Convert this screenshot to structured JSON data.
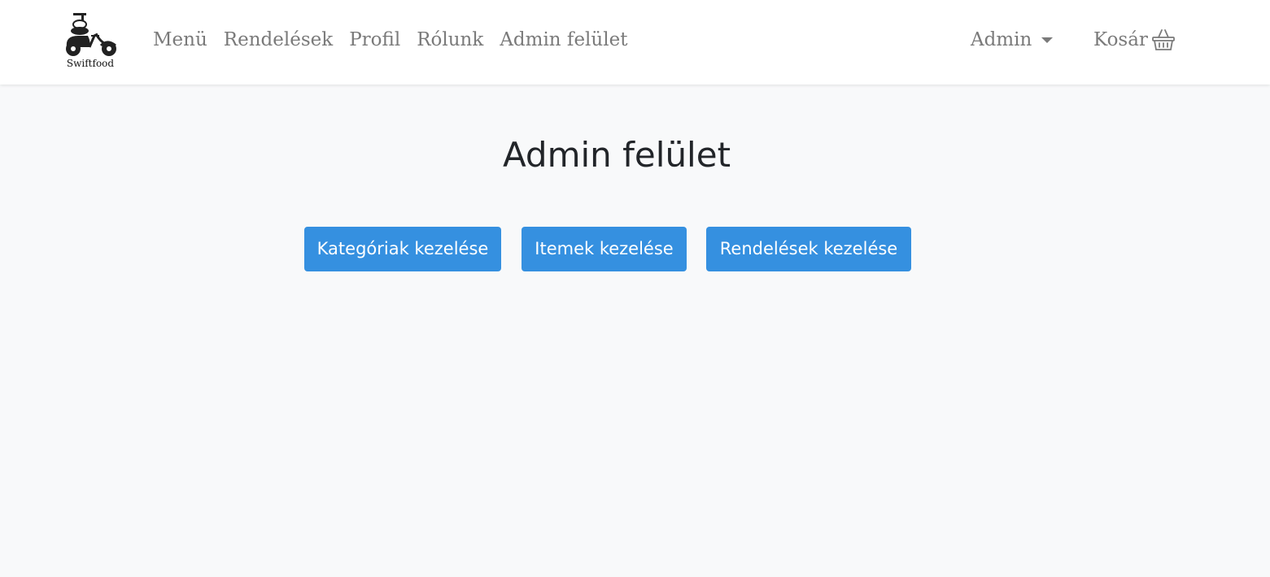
{
  "navbar": {
    "logo_text": "Swiftfood",
    "links": [
      "Menü",
      "Rendelések",
      "Profil",
      "Rólunk",
      "Admin felület"
    ],
    "admin_label": "Admin",
    "cart_label": "Kosár"
  },
  "main": {
    "title": "Admin felület",
    "buttons": {
      "categories": "Kategóriak kezelése",
      "items": "Itemek kezelése",
      "orders": "Rendelések kezelése"
    }
  },
  "colors": {
    "primary_button": "#3590e0",
    "page_background": "#f8f9fa",
    "nav_text": "#7a7a7a"
  },
  "icons": [
    "scooter-logo-icon",
    "caret-down-icon",
    "basket-icon"
  ]
}
